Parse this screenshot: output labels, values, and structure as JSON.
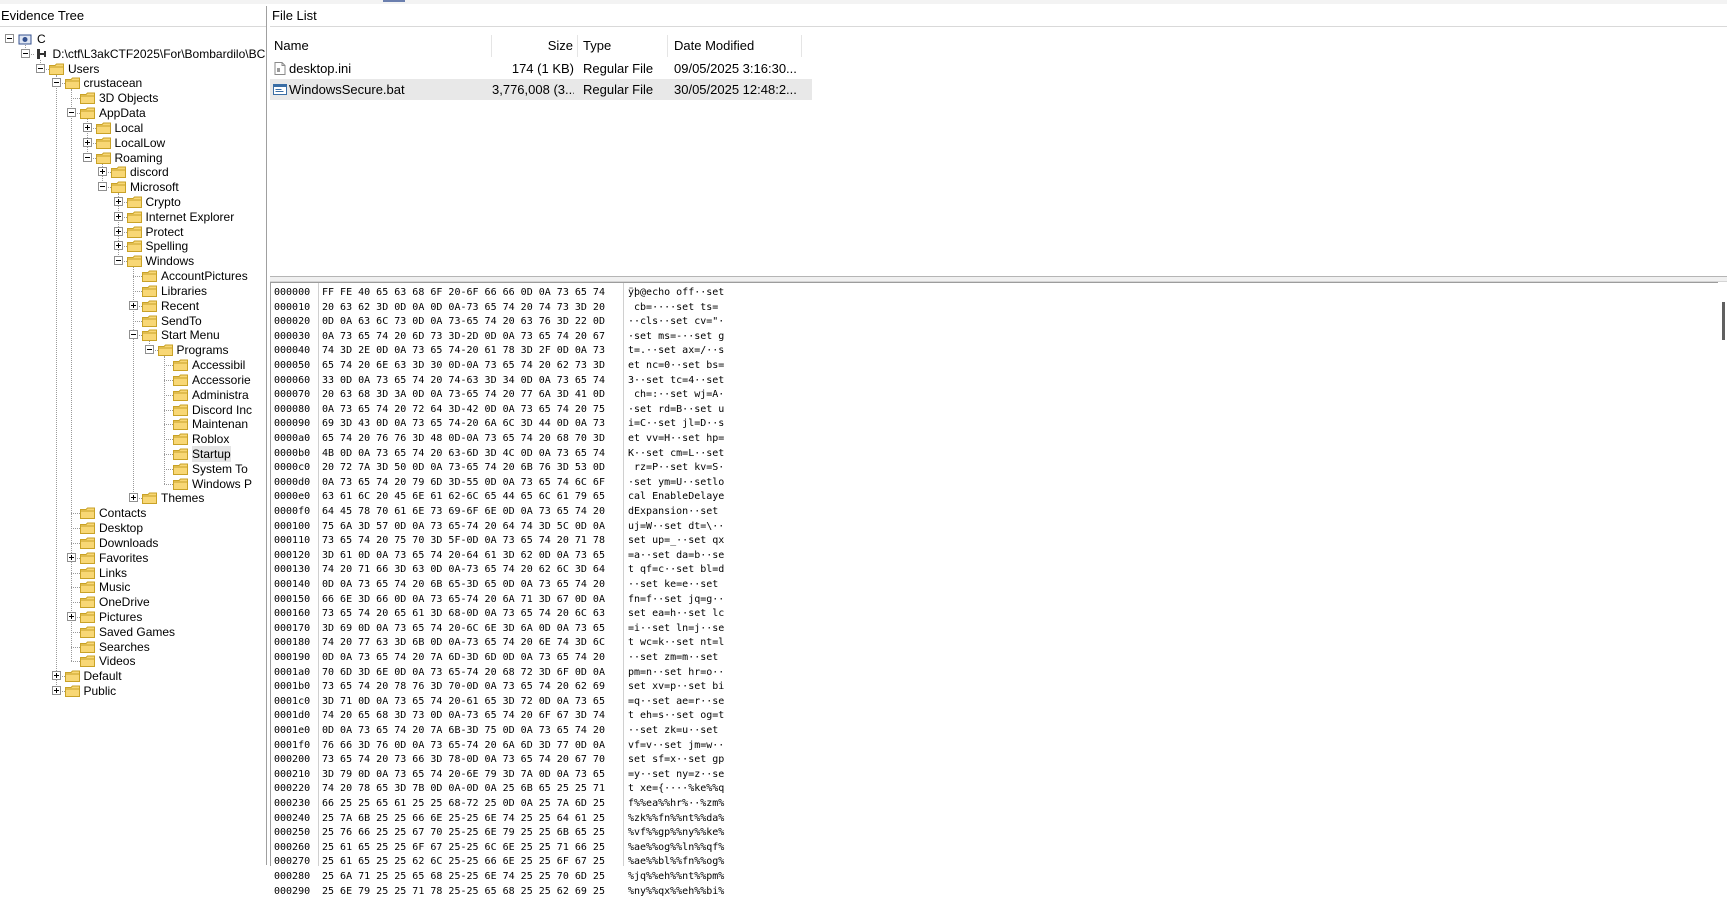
{
  "evidence_tree": {
    "title": "Evidence Tree",
    "nodes": [
      {
        "label": "C",
        "indent": 0,
        "expander": "minus",
        "icon": "drive"
      },
      {
        "label": "D:\\ctf\\L3akCTF2025\\For\\Bombardilo\\BC",
        "indent": 1,
        "expander": "minus",
        "icon": "volume"
      },
      {
        "label": "Users",
        "indent": 2,
        "expander": "minus",
        "icon": "folder"
      },
      {
        "label": "crustacean",
        "indent": 3,
        "expander": "minus",
        "icon": "folder"
      },
      {
        "label": "3D Objects",
        "indent": 4,
        "expander": "none",
        "icon": "folder"
      },
      {
        "label": "AppData",
        "indent": 4,
        "expander": "minus",
        "icon": "folder"
      },
      {
        "label": "Local",
        "indent": 5,
        "expander": "plus",
        "icon": "folder"
      },
      {
        "label": "LocalLow",
        "indent": 5,
        "expander": "plus",
        "icon": "folder"
      },
      {
        "label": "Roaming",
        "indent": 5,
        "expander": "minus",
        "icon": "folder"
      },
      {
        "label": "discord",
        "indent": 6,
        "expander": "plus",
        "icon": "folder"
      },
      {
        "label": "Microsoft",
        "indent": 6,
        "expander": "minus",
        "icon": "folder"
      },
      {
        "label": "Crypto",
        "indent": 7,
        "expander": "plus",
        "icon": "folder"
      },
      {
        "label": "Internet Explorer",
        "indent": 7,
        "expander": "plus",
        "icon": "folder"
      },
      {
        "label": "Protect",
        "indent": 7,
        "expander": "plus",
        "icon": "folder"
      },
      {
        "label": "Spelling",
        "indent": 7,
        "expander": "plus",
        "icon": "folder"
      },
      {
        "label": "Windows",
        "indent": 7,
        "expander": "minus",
        "icon": "folder"
      },
      {
        "label": "AccountPictures",
        "indent": 8,
        "expander": "none",
        "icon": "folder"
      },
      {
        "label": "Libraries",
        "indent": 8,
        "expander": "none",
        "icon": "folder"
      },
      {
        "label": "Recent",
        "indent": 8,
        "expander": "plus",
        "icon": "folder"
      },
      {
        "label": "SendTo",
        "indent": 8,
        "expander": "none",
        "icon": "folder"
      },
      {
        "label": "Start Menu",
        "indent": 8,
        "expander": "minus",
        "icon": "folder"
      },
      {
        "label": "Programs",
        "indent": 9,
        "expander": "minus",
        "icon": "folder"
      },
      {
        "label": "Accessibil",
        "indent": 10,
        "expander": "none",
        "icon": "folder"
      },
      {
        "label": "Accessorie",
        "indent": 10,
        "expander": "none",
        "icon": "folder"
      },
      {
        "label": "Administra",
        "indent": 10,
        "expander": "none",
        "icon": "folder"
      },
      {
        "label": "Discord Inc",
        "indent": 10,
        "expander": "none",
        "icon": "folder"
      },
      {
        "label": "Maintenan",
        "indent": 10,
        "expander": "none",
        "icon": "folder"
      },
      {
        "label": "Roblox",
        "indent": 10,
        "expander": "none",
        "icon": "folder"
      },
      {
        "label": "Startup",
        "indent": 10,
        "expander": "none",
        "icon": "folder",
        "selected": true
      },
      {
        "label": "System To",
        "indent": 10,
        "expander": "none",
        "icon": "folder"
      },
      {
        "label": "Windows P",
        "indent": 10,
        "expander": "none",
        "icon": "folder"
      },
      {
        "label": "Themes",
        "indent": 8,
        "expander": "plus",
        "icon": "folder"
      },
      {
        "label": "Contacts",
        "indent": 4,
        "expander": "none",
        "icon": "folder"
      },
      {
        "label": "Desktop",
        "indent": 4,
        "expander": "none",
        "icon": "folder"
      },
      {
        "label": "Downloads",
        "indent": 4,
        "expander": "none",
        "icon": "folder"
      },
      {
        "label": "Favorites",
        "indent": 4,
        "expander": "plus",
        "icon": "folder"
      },
      {
        "label": "Links",
        "indent": 4,
        "expander": "none",
        "icon": "folder"
      },
      {
        "label": "Music",
        "indent": 4,
        "expander": "none",
        "icon": "folder"
      },
      {
        "label": "OneDrive",
        "indent": 4,
        "expander": "none",
        "icon": "folder"
      },
      {
        "label": "Pictures",
        "indent": 4,
        "expander": "plus",
        "icon": "folder"
      },
      {
        "label": "Saved Games",
        "indent": 4,
        "expander": "none",
        "icon": "folder"
      },
      {
        "label": "Searches",
        "indent": 4,
        "expander": "none",
        "icon": "folder"
      },
      {
        "label": "Videos",
        "indent": 4,
        "expander": "none",
        "icon": "folder"
      },
      {
        "label": "Default",
        "indent": 3,
        "expander": "plus",
        "icon": "folder"
      },
      {
        "label": "Public",
        "indent": 3,
        "expander": "plus",
        "icon": "folder"
      }
    ]
  },
  "file_list": {
    "title": "File List",
    "columns": {
      "name": "Name",
      "size": "Size",
      "type": "Type",
      "date": "Date Modified"
    },
    "rows": [
      {
        "name": "desktop.ini",
        "size": "174 (1 KB)",
        "type": "Regular File",
        "date": "09/05/2025 3:16:30...",
        "icon": "ini-file-icon",
        "selected": false
      },
      {
        "name": "WindowsSecure.bat",
        "size": "3,776,008 (3...",
        "type": "Regular File",
        "date": "30/05/2025 12:48:2...",
        "icon": "batch-file-icon",
        "selected": true
      }
    ]
  },
  "hex_view": {
    "rows": [
      {
        "off": "000000",
        "hex": "FF FE 40 65 63 68 6F 20-6F 66 66 0D 0A 73 65 74",
        "ascii": "ÿþ@echo off··set"
      },
      {
        "off": "000010",
        "hex": "20 63 62 3D 0D 0A 0D 0A-73 65 74 20 74 73 3D 20",
        "ascii": " cb=····set ts= "
      },
      {
        "off": "000020",
        "hex": "0D 0A 63 6C 73 0D 0A 73-65 74 20 63 76 3D 22 0D",
        "ascii": "··cls··set cv=\"·"
      },
      {
        "off": "000030",
        "hex": "0A 73 65 74 20 6D 73 3D-2D 0D 0A 73 65 74 20 67",
        "ascii": "·set ms=-··set g"
      },
      {
        "off": "000040",
        "hex": "74 3D 2E 0D 0A 73 65 74-20 61 78 3D 2F 0D 0A 73",
        "ascii": "t=.··set ax=/··s"
      },
      {
        "off": "000050",
        "hex": "65 74 20 6E 63 3D 30 0D-0A 73 65 74 20 62 73 3D",
        "ascii": "et nc=0··set bs="
      },
      {
        "off": "000060",
        "hex": "33 0D 0A 73 65 74 20 74-63 3D 34 0D 0A 73 65 74",
        "ascii": "3··set tc=4··set"
      },
      {
        "off": "000070",
        "hex": "20 63 68 3D 3A 0D 0A 73-65 74 20 77 6A 3D 41 0D",
        "ascii": " ch=:··set wj=A·"
      },
      {
        "off": "000080",
        "hex": "0A 73 65 74 20 72 64 3D-42 0D 0A 73 65 74 20 75",
        "ascii": "·set rd=B··set u"
      },
      {
        "off": "000090",
        "hex": "69 3D 43 0D 0A 73 65 74-20 6A 6C 3D 44 0D 0A 73",
        "ascii": "i=C··set jl=D··s"
      },
      {
        "off": "0000a0",
        "hex": "65 74 20 76 76 3D 48 0D-0A 73 65 74 20 68 70 3D",
        "ascii": "et vv=H··set hp="
      },
      {
        "off": "0000b0",
        "hex": "4B 0D 0A 73 65 74 20 63-6D 3D 4C 0D 0A 73 65 74",
        "ascii": "K··set cm=L··set"
      },
      {
        "off": "0000c0",
        "hex": "20 72 7A 3D 50 0D 0A 73-65 74 20 6B 76 3D 53 0D",
        "ascii": " rz=P··set kv=S·"
      },
      {
        "off": "0000d0",
        "hex": "0A 73 65 74 20 79 6D 3D-55 0D 0A 73 65 74 6C 6F",
        "ascii": "·set ym=U··setlo"
      },
      {
        "off": "0000e0",
        "hex": "63 61 6C 20 45 6E 61 62-6C 65 44 65 6C 61 79 65",
        "ascii": "cal EnableDelaye"
      },
      {
        "off": "0000f0",
        "hex": "64 45 78 70 61 6E 73 69-6F 6E 0D 0A 73 65 74 20",
        "ascii": "dExpansion··set "
      },
      {
        "off": "000100",
        "hex": "75 6A 3D 57 0D 0A 73 65-74 20 64 74 3D 5C 0D 0A",
        "ascii": "uj=W··set dt=\\··"
      },
      {
        "off": "000110",
        "hex": "73 65 74 20 75 70 3D 5F-0D 0A 73 65 74 20 71 78",
        "ascii": "set up=_··set qx"
      },
      {
        "off": "000120",
        "hex": "3D 61 0D 0A 73 65 74 20-64 61 3D 62 0D 0A 73 65",
        "ascii": "=a··set da=b··se"
      },
      {
        "off": "000130",
        "hex": "74 20 71 66 3D 63 0D 0A-73 65 74 20 62 6C 3D 64",
        "ascii": "t qf=c··set bl=d"
      },
      {
        "off": "000140",
        "hex": "0D 0A 73 65 74 20 6B 65-3D 65 0D 0A 73 65 74 20",
        "ascii": "··set ke=e··set "
      },
      {
        "off": "000150",
        "hex": "66 6E 3D 66 0D 0A 73 65-74 20 6A 71 3D 67 0D 0A",
        "ascii": "fn=f··set jq=g··"
      },
      {
        "off": "000160",
        "hex": "73 65 74 20 65 61 3D 68-0D 0A 73 65 74 20 6C 63",
        "ascii": "set ea=h··set lc"
      },
      {
        "off": "000170",
        "hex": "3D 69 0D 0A 73 65 74 20-6C 6E 3D 6A 0D 0A 73 65",
        "ascii": "=i··set ln=j··se"
      },
      {
        "off": "000180",
        "hex": "74 20 77 63 3D 6B 0D 0A-73 65 74 20 6E 74 3D 6C",
        "ascii": "t wc=k··set nt=l"
      },
      {
        "off": "000190",
        "hex": "0D 0A 73 65 74 20 7A 6D-3D 6D 0D 0A 73 65 74 20",
        "ascii": "··set zm=m··set "
      },
      {
        "off": "0001a0",
        "hex": "70 6D 3D 6E 0D 0A 73 65-74 20 68 72 3D 6F 0D 0A",
        "ascii": "pm=n··set hr=o··"
      },
      {
        "off": "0001b0",
        "hex": "73 65 74 20 78 76 3D 70-0D 0A 73 65 74 20 62 69",
        "ascii": "set xv=p··set bi"
      },
      {
        "off": "0001c0",
        "hex": "3D 71 0D 0A 73 65 74 20-61 65 3D 72 0D 0A 73 65",
        "ascii": "=q··set ae=r··se"
      },
      {
        "off": "0001d0",
        "hex": "74 20 65 68 3D 73 0D 0A-73 65 74 20 6F 67 3D 74",
        "ascii": "t eh=s··set og=t"
      },
      {
        "off": "0001e0",
        "hex": "0D 0A 73 65 74 20 7A 6B-3D 75 0D 0A 73 65 74 20",
        "ascii": "··set zk=u··set "
      },
      {
        "off": "0001f0",
        "hex": "76 66 3D 76 0D 0A 73 65-74 20 6A 6D 3D 77 0D 0A",
        "ascii": "vf=v··set jm=w··"
      },
      {
        "off": "000200",
        "hex": "73 65 74 20 73 66 3D 78-0D 0A 73 65 74 20 67 70",
        "ascii": "set sf=x··set gp"
      },
      {
        "off": "000210",
        "hex": "3D 79 0D 0A 73 65 74 20-6E 79 3D 7A 0D 0A 73 65",
        "ascii": "=y··set ny=z··se"
      },
      {
        "off": "000220",
        "hex": "74 20 78 65 3D 7B 0D 0A-0D 0A 25 6B 65 25 25 71",
        "ascii": "t xe={····%ke%%q"
      },
      {
        "off": "000230",
        "hex": "66 25 25 65 61 25 25 68-72 25 0D 0A 25 7A 6D 25",
        "ascii": "f%%ea%%hr%··%zm%"
      },
      {
        "off": "000240",
        "hex": "25 7A 6B 25 25 66 6E 25-25 6E 74 25 25 64 61 25",
        "ascii": "%zk%%fn%%nt%%da%"
      },
      {
        "off": "000250",
        "hex": "25 76 66 25 25 67 70 25-25 6E 79 25 25 6B 65 25",
        "ascii": "%vf%%gp%%ny%%ke%"
      },
      {
        "off": "000260",
        "hex": "25 61 65 25 25 6F 67 25-25 6C 6E 25 25 71 66 25",
        "ascii": "%ae%%og%%ln%%qf%"
      },
      {
        "off": "000270",
        "hex": "25 61 65 25 25 62 6C 25-25 66 6E 25 25 6F 67 25",
        "ascii": "%ae%%bl%%fn%%og%"
      },
      {
        "off": "000280",
        "hex": "25 6A 71 25 25 65 68 25-25 6E 74 25 25 70 6D 25",
        "ascii": "%jq%%eh%%nt%%pm%"
      },
      {
        "off": "000290",
        "hex": "25 6E 79 25 25 71 78 25-25 65 68 25 25 62 69 25",
        "ascii": "%ny%%qx%%eh%%bi%"
      }
    ]
  },
  "colors": {
    "folder_fill": "#f8d775",
    "folder_stroke": "#c9a227",
    "selection": "#e5e5e5"
  }
}
